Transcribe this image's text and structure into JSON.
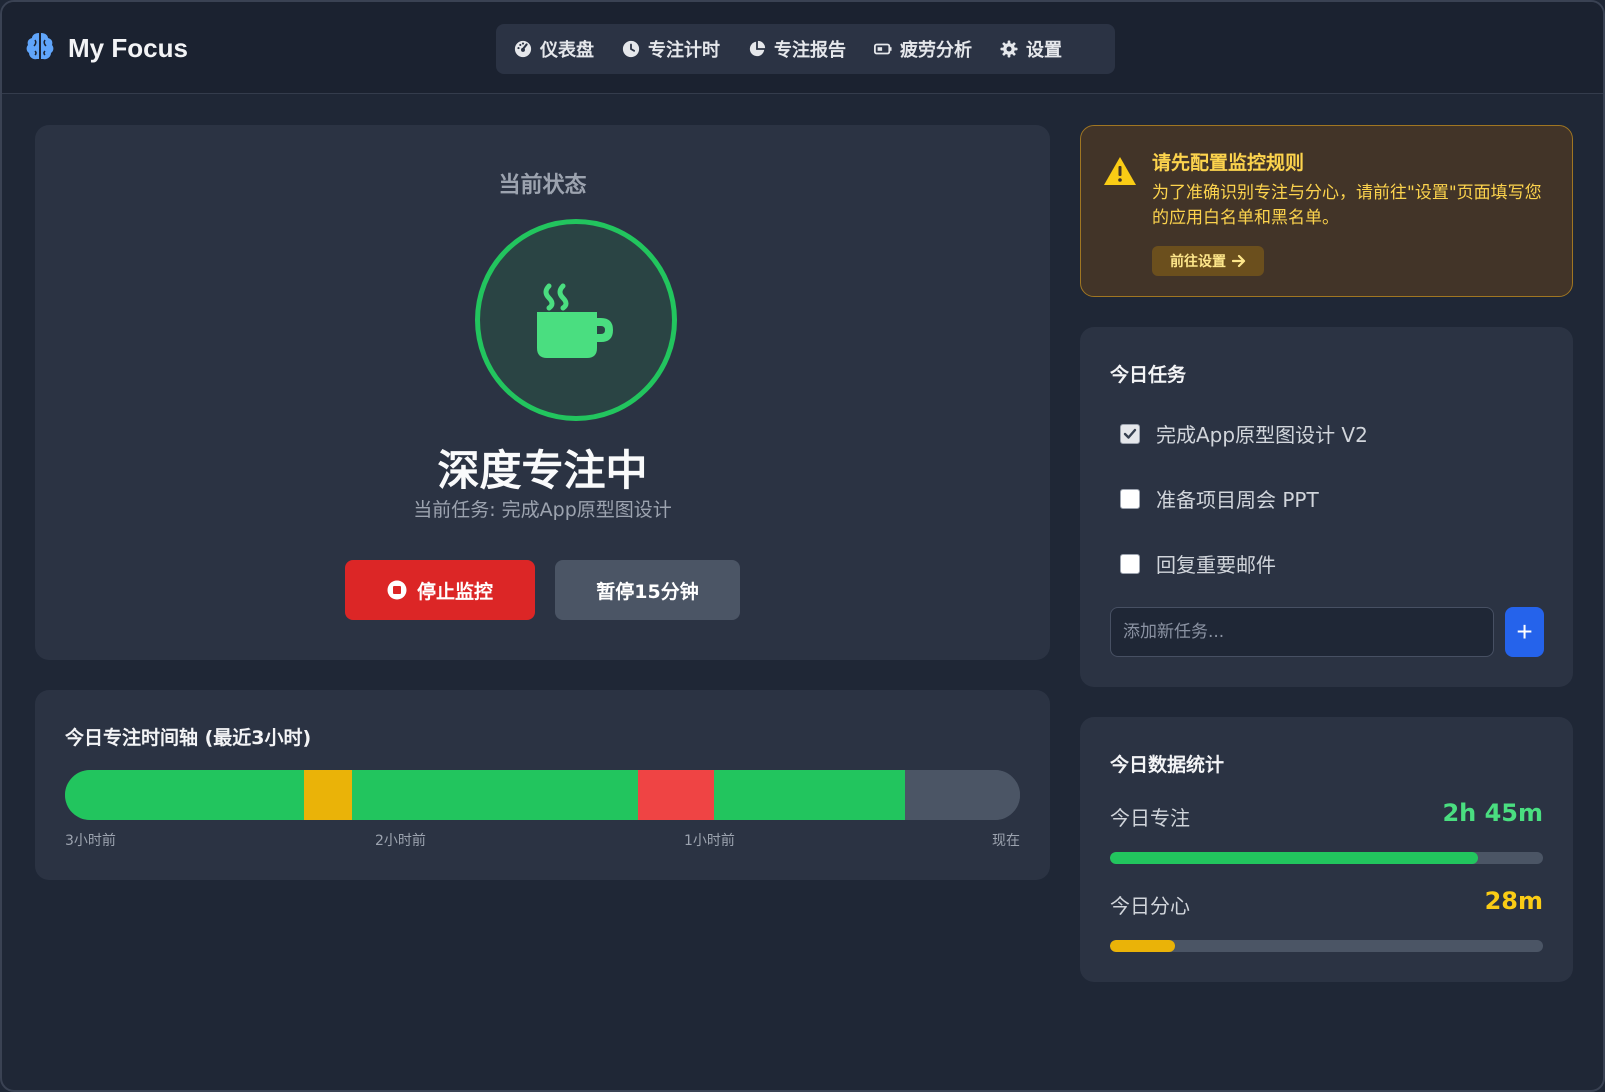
{
  "header": {
    "app_title": "My Focus",
    "nav": [
      {
        "label": "仪表盘",
        "icon": "gauge-icon"
      },
      {
        "label": "专注计时",
        "icon": "clock-icon"
      },
      {
        "label": "专注报告",
        "icon": "pie-chart-icon"
      },
      {
        "label": "疲劳分析",
        "icon": "battery-icon"
      },
      {
        "label": "设置",
        "icon": "gear-icon"
      }
    ]
  },
  "status": {
    "label": "当前状态",
    "title": "深度专注中",
    "task": "当前任务: 完成App原型图设计",
    "stop_button": "停止监控",
    "pause_button": "暂停15分钟",
    "ring_color": "#22c55e"
  },
  "timeline": {
    "title": "今日专注时间轴 (最近3小时)",
    "segments": [
      {
        "state": "focus",
        "fraction": 0.25,
        "color": "#22c55e"
      },
      {
        "state": "distract",
        "fraction": 0.05,
        "color": "#eab308"
      },
      {
        "state": "focus",
        "fraction": 0.3,
        "color": "#22c55e"
      },
      {
        "state": "off-task",
        "fraction": 0.08,
        "color": "#ef4444"
      },
      {
        "state": "focus",
        "fraction": 0.2,
        "color": "#22c55e"
      },
      {
        "state": "none",
        "fraction": 0.12,
        "color": "#4b5565"
      }
    ],
    "labels": [
      "3小时前",
      "2小时前",
      "1小时前",
      "现在"
    ]
  },
  "warning": {
    "title": "请先配置监控规则",
    "text": "为了准确识别专注与分心，请前往\"设置\"页面填写您的应用白名单和黑名单。",
    "button": "前往设置"
  },
  "tasks": {
    "title": "今日任务",
    "items": [
      {
        "label": "完成App原型图设计 V2",
        "checked": true
      },
      {
        "label": "准备项目周会 PPT",
        "checked": false
      },
      {
        "label": "回复重要邮件",
        "checked": false
      }
    ],
    "input_placeholder": "添加新任务...",
    "add_button": "+"
  },
  "stats": {
    "title": "今日数据统计",
    "focus_label": "今日专注",
    "focus_value": "2h 45m",
    "focus_fraction": 0.85,
    "focus_color": "#4ade80",
    "distract_label": "今日分心",
    "distract_value": "28m",
    "distract_fraction": 0.15,
    "distract_color": "#facc15"
  }
}
